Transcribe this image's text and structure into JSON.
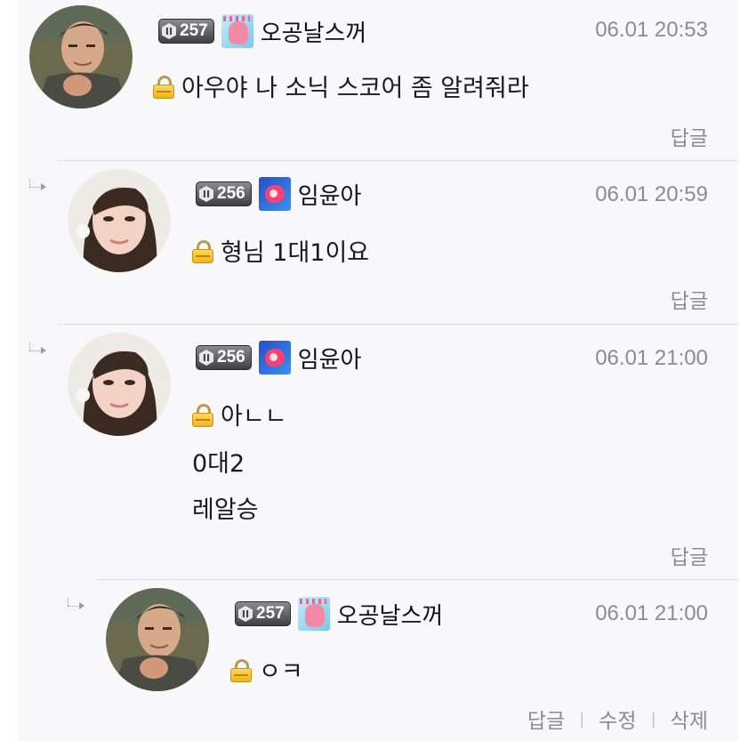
{
  "comments": [
    {
      "level": "257",
      "nickname": "오공날스꺼",
      "date": "06.01 20:53",
      "lines": [
        "아우야 나 소닉 스코어 좀 알려줘라"
      ],
      "reply_label": "답글"
    },
    {
      "level": "256",
      "nickname": "임윤아",
      "date": "06.01 20:59",
      "lines": [
        "형님 1대1이요"
      ],
      "reply_label": "답글"
    },
    {
      "level": "256",
      "nickname": "임윤아",
      "date": "06.01 21:00",
      "lines": [
        "아ㄴㄴ",
        "0대2",
        "레알승"
      ],
      "reply_label": "답글"
    },
    {
      "level": "257",
      "nickname": "오공날스꺼",
      "date": "06.01 21:00",
      "lines": [
        "ㅇㅋ"
      ],
      "reply_label": "답글",
      "edit_label": "수정",
      "delete_label": "삭제"
    }
  ],
  "colors": {
    "background": "#f8f8fb",
    "divider": "#dcdcdc",
    "date_text": "#8c8c8c",
    "lock": "#f2b21a"
  },
  "icons": [
    "lock-icon",
    "level-badge-icon",
    "profile-badge-icon",
    "reply-arrow-icon"
  ]
}
